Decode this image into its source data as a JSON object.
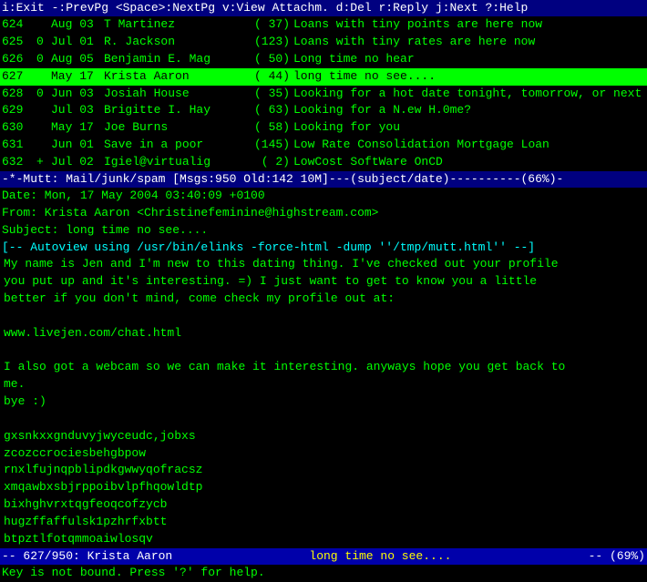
{
  "topbar": {
    "label": "i:Exit  -:PrevPg  <Space>:NextPg  v:View Attachm.  d:Del  r:Reply  j:Next  ?:Help"
  },
  "emails": [
    {
      "id": "624",
      "flag": " ",
      "date": "Aug 03",
      "sender": "T Martinez",
      "count": "( 37)",
      "subject": "Loans with tiny points are here now",
      "selected": false
    },
    {
      "id": "625",
      "flag": "0",
      "date": "Jul 01",
      "sender": "R. Jackson",
      "count": "(123)",
      "subject": "Loans with tiny rates are here now",
      "selected": false
    },
    {
      "id": "626",
      "flag": "0",
      "date": "Aug 05",
      "sender": "Benjamin E. Mag",
      "count": "( 50)",
      "subject": "Long time no hear",
      "selected": false
    },
    {
      "id": "627",
      "flag": " ",
      "date": "May 17",
      "sender": "Krista Aaron",
      "count": "( 44)",
      "subject": "long time no see....",
      "selected": true
    },
    {
      "id": "628",
      "flag": "0",
      "date": "Jun 03",
      "sender": "Josiah House",
      "count": "( 35)",
      "subject": "Looking for a hot date tonight, tomorrow, or next week?",
      "selected": false
    },
    {
      "id": "629",
      "flag": " ",
      "date": "Jul 03",
      "sender": "Brigitte I. Hay",
      "count": "( 63)",
      "subject": "Looking for a N.ew H.0me?",
      "selected": false
    },
    {
      "id": "630",
      "flag": " ",
      "date": "May 17",
      "sender": "Joe Burns",
      "count": "( 58)",
      "subject": "Looking for you",
      "selected": false
    },
    {
      "id": "631",
      "flag": " ",
      "date": "Jun 01",
      "sender": "Save in a poor",
      "count": "(145)",
      "subject": "Low Rate Consolidation Mortgage Loan",
      "selected": false
    },
    {
      "id": "632",
      "flag": "+",
      "date": "Jul 02",
      "sender": "Igiel@virtualig",
      "count": "( 2)",
      "subject": "LowCost SoftWare OnCD",
      "selected": false
    }
  ],
  "mutt_status": {
    "text": "-*-Mutt: Mail/junk/spam [Msgs:950 Old:142 10M]---(subject/date)----------(66%)-"
  },
  "email_header": {
    "date": "Date: Mon, 17 May 2004 03:40:09 +0100",
    "from": "From: Krista Aaron <Christinefeminine@highstream.com>",
    "subject": "Subject: long time no see...."
  },
  "autoview": {
    "text": "[-- Autoview using /usr/bin/elinks -force-html -dump ''/tmp/mutt.html'' --]"
  },
  "message": {
    "line1": "My name is Jen and I'm new to this dating thing. I've checked out your profile",
    "line2": "you put up and it's interesting. =) I just want to get to know you a little",
    "line3": "      better if you don't mind, come check my profile out at:",
    "line4": "",
    "line5": "              www.livejen.com/chat.html",
    "line6": "",
    "line7": "I also got a webcam so we can make it interesting. anyways hope you get back to",
    "line8": "                                    me.",
    "line9": "                                  bye :)",
    "line10": "",
    "line11": "          gxsnkxxgnduvyjwyceudc,jobxs",
    "line12": "              zcozccrociesbehgbpow",
    "line13": "          rnxlfujnqpblipdkgwwyqofracsz",
    "line14": "          xmqawbxsbjrppoibvlpfhqowldtp",
    "line15": "          bixhghvrxtqgfeoqcofzycb",
    "line16": "          hugzffaffulsk1pzhrfxbtt",
    "line17": "          btpztlfotqmmoaiwlosqv"
  },
  "bottom_status": {
    "left": "-- 627/950: Krista Aaron",
    "center": "long time no see....",
    "right": "-- (69%)"
  },
  "key_hint": {
    "text": "Key is not bound.  Press '?' for help."
  }
}
